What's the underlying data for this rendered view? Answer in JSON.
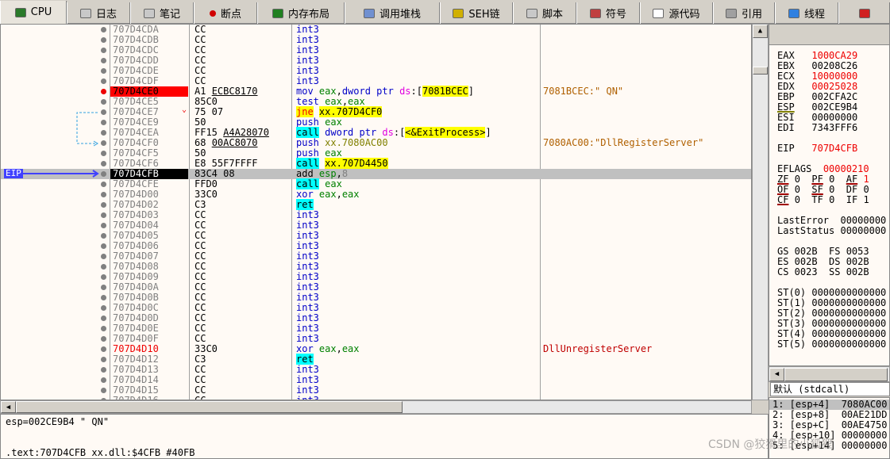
{
  "tabs": [
    {
      "label": "CPU",
      "icon": "cpu-icon",
      "color": "#2a7a2a",
      "active": true
    },
    {
      "label": "日志",
      "icon": "log-icon",
      "color": "#c8c8c8"
    },
    {
      "label": "笔记",
      "icon": "notes-icon",
      "color": "#c8c8c8"
    },
    {
      "label": "断点",
      "icon": "breakpoint-icon",
      "color": "#d00000"
    },
    {
      "label": "内存布局",
      "icon": "memory-map-icon",
      "color": "#208020"
    },
    {
      "label": "调用堆栈",
      "icon": "call-stack-icon",
      "color": "#7090d0"
    },
    {
      "label": "SEH链",
      "icon": "seh-chain-icon",
      "color": "#d0b000"
    },
    {
      "label": "脚本",
      "icon": "script-icon",
      "color": "#c8c8c8"
    },
    {
      "label": "符号",
      "icon": "symbols-icon",
      "color": "#c04040"
    },
    {
      "label": "源代码",
      "icon": "source-code-icon",
      "color": "#ffffff"
    },
    {
      "label": "引用",
      "icon": "references-icon",
      "color": "#a0a0a0"
    },
    {
      "label": "线程",
      "icon": "threads-icon",
      "color": "#3080e0"
    },
    {
      "label": "",
      "icon": "handles-icon",
      "color": "#d02020"
    }
  ],
  "disasm": {
    "eip_label": "EIP",
    "rows": [
      {
        "addr": "707D4CDA",
        "bytes": "CC",
        "ins": [
          [
            "mn",
            "int3"
          ]
        ]
      },
      {
        "addr": "707D4CDB",
        "bytes": "CC",
        "ins": [
          [
            "mn",
            "int3"
          ]
        ]
      },
      {
        "addr": "707D4CDC",
        "bytes": "CC",
        "ins": [
          [
            "mn",
            "int3"
          ]
        ]
      },
      {
        "addr": "707D4CDD",
        "bytes": "CC",
        "ins": [
          [
            "mn",
            "int3"
          ]
        ]
      },
      {
        "addr": "707D4CDE",
        "bytes": "CC",
        "ins": [
          [
            "mn",
            "int3"
          ]
        ]
      },
      {
        "addr": "707D4CDF",
        "bytes": "CC",
        "ins": [
          [
            "mn",
            "int3"
          ]
        ]
      },
      {
        "addr": "707D4CE0",
        "bytes": "A1 ",
        "bytes_u": "ECBC8170",
        "state": "bp",
        "ins": [
          [
            "mn",
            "mov "
          ],
          [
            "rg",
            "eax"
          ],
          [
            "pl",
            ","
          ],
          [
            "mn",
            "dword ptr "
          ],
          [
            "sg",
            "ds"
          ],
          [
            "pl",
            ":["
          ],
          [
            "hy",
            "7081BCEC"
          ],
          [
            "pl",
            "]"
          ]
        ],
        "comment": "7081BCEC:\" QN\""
      },
      {
        "addr": "707D4CE5",
        "bytes": "85C0",
        "ins": [
          [
            "mn",
            "test "
          ],
          [
            "rg",
            "eax"
          ],
          [
            "pl",
            ","
          ],
          [
            "rg",
            "eax"
          ]
        ]
      },
      {
        "addr": "707D4CE7",
        "bytes": "75 07",
        "jump": true,
        "ins": [
          [
            "jn",
            "jne"
          ],
          [
            "pl",
            " "
          ],
          [
            "hy",
            "xx.707D4CF0"
          ]
        ]
      },
      {
        "addr": "707D4CE9",
        "bytes": "50",
        "ins": [
          [
            "mn",
            "push "
          ],
          [
            "rg",
            "eax"
          ]
        ]
      },
      {
        "addr": "707D4CEA",
        "bytes": "FF15 ",
        "bytes_u": "A4A28070",
        "ins": [
          [
            "hc",
            "call"
          ],
          [
            "pl",
            " "
          ],
          [
            "mn",
            "dword ptr "
          ],
          [
            "sg",
            "ds"
          ],
          [
            "pl",
            ":["
          ],
          [
            "hy",
            "<&ExitProcess>"
          ],
          [
            "pl",
            "]"
          ]
        ]
      },
      {
        "addr": "707D4CF0",
        "bytes": "68 ",
        "bytes_u": "00AC8070",
        "ins": [
          [
            "mn",
            "push "
          ],
          [
            "ol",
            "xx.7080AC00"
          ]
        ],
        "comment": "7080AC00:\"DllRegisterServer\""
      },
      {
        "addr": "707D4CF5",
        "bytes": "50",
        "ins": [
          [
            "mn",
            "push "
          ],
          [
            "rg",
            "eax"
          ]
        ]
      },
      {
        "addr": "707D4CF6",
        "bytes": "E8 55F7FFFF",
        "ins": [
          [
            "hc",
            "call"
          ],
          [
            "pl",
            " "
          ],
          [
            "hy",
            "xx.707D4450"
          ]
        ]
      },
      {
        "addr": "707D4CFB",
        "bytes": "83C4 08",
        "state": "eip",
        "ins": [
          [
            "pl",
            "add "
          ],
          [
            "rg",
            "esp"
          ],
          [
            "pl",
            ","
          ],
          [
            "gy",
            "8"
          ]
        ]
      },
      {
        "addr": "707D4CFE",
        "bytes": "FFD0",
        "ins": [
          [
            "hc",
            "call"
          ],
          [
            "pl",
            " "
          ],
          [
            "rg",
            "eax"
          ]
        ]
      },
      {
        "addr": "707D4D00",
        "bytes": "33C0",
        "ins": [
          [
            "mn",
            "xor "
          ],
          [
            "rg",
            "eax"
          ],
          [
            "pl",
            ","
          ],
          [
            "rg",
            "eax"
          ]
        ]
      },
      {
        "addr": "707D4D02",
        "bytes": "C3",
        "ins": [
          [
            "hc",
            "ret"
          ]
        ]
      },
      {
        "addr": "707D4D03",
        "bytes": "CC",
        "ins": [
          [
            "mn",
            "int3"
          ]
        ]
      },
      {
        "addr": "707D4D04",
        "bytes": "CC",
        "ins": [
          [
            "mn",
            "int3"
          ]
        ]
      },
      {
        "addr": "707D4D05",
        "bytes": "CC",
        "ins": [
          [
            "mn",
            "int3"
          ]
        ]
      },
      {
        "addr": "707D4D06",
        "bytes": "CC",
        "ins": [
          [
            "mn",
            "int3"
          ]
        ]
      },
      {
        "addr": "707D4D07",
        "bytes": "CC",
        "ins": [
          [
            "mn",
            "int3"
          ]
        ]
      },
      {
        "addr": "707D4D08",
        "bytes": "CC",
        "ins": [
          [
            "mn",
            "int3"
          ]
        ]
      },
      {
        "addr": "707D4D09",
        "bytes": "CC",
        "ins": [
          [
            "mn",
            "int3"
          ]
        ]
      },
      {
        "addr": "707D4D0A",
        "bytes": "CC",
        "ins": [
          [
            "mn",
            "int3"
          ]
        ]
      },
      {
        "addr": "707D4D0B",
        "bytes": "CC",
        "ins": [
          [
            "mn",
            "int3"
          ]
        ]
      },
      {
        "addr": "707D4D0C",
        "bytes": "CC",
        "ins": [
          [
            "mn",
            "int3"
          ]
        ]
      },
      {
        "addr": "707D4D0D",
        "bytes": "CC",
        "ins": [
          [
            "mn",
            "int3"
          ]
        ]
      },
      {
        "addr": "707D4D0E",
        "bytes": "CC",
        "ins": [
          [
            "mn",
            "int3"
          ]
        ]
      },
      {
        "addr": "707D4D0F",
        "bytes": "CC",
        "ins": [
          [
            "mn",
            "int3"
          ]
        ]
      },
      {
        "addr": "707D4D10",
        "bytes": "33C0",
        "state": "red",
        "ins": [
          [
            "mn",
            "xor "
          ],
          [
            "rg",
            "eax"
          ],
          [
            "pl",
            ","
          ],
          [
            "rg",
            "eax"
          ]
        ],
        "comment": "DllUnregisterServer",
        "comment_color": "#c00000"
      },
      {
        "addr": "707D4D12",
        "bytes": "C3",
        "ins": [
          [
            "hc",
            "ret"
          ]
        ]
      },
      {
        "addr": "707D4D13",
        "bytes": "CC",
        "ins": [
          [
            "mn",
            "int3"
          ]
        ]
      },
      {
        "addr": "707D4D14",
        "bytes": "CC",
        "ins": [
          [
            "mn",
            "int3"
          ]
        ]
      },
      {
        "addr": "707D4D15",
        "bytes": "CC",
        "ins": [
          [
            "mn",
            "int3"
          ]
        ]
      },
      {
        "addr": "707D4D16",
        "bytes": "CC",
        "ins": [
          [
            "mn",
            "int3"
          ]
        ]
      }
    ]
  },
  "info": {
    "line1": "esp=002CE9B4 \" QN\"",
    "line2": ".text:707D4CFB xx.dll:$4CFB #40FB"
  },
  "registers": {
    "gp": [
      {
        "name": "EAX",
        "value": "1000CA29",
        "changed": true
      },
      {
        "name": "EBX",
        "value": "00208C26"
      },
      {
        "name": "ECX",
        "value": "10000000",
        "changed": true
      },
      {
        "name": "EDX",
        "value": "00025028",
        "changed": true
      },
      {
        "name": "EBP",
        "value": "002CFA2C"
      },
      {
        "name": "ESP",
        "value": "002CE9B4",
        "underline": true
      },
      {
        "name": "ESI",
        "value": "00000000"
      },
      {
        "name": "EDI",
        "value": "7343FFF6"
      }
    ],
    "eip": {
      "name": "EIP",
      "value": "707D4CFB"
    },
    "eflags": {
      "name": "EFLAGS",
      "value": "00000210"
    },
    "flags": [
      [
        {
          "n": "ZF",
          "v": "0",
          "u": true
        },
        {
          "n": "PF",
          "v": "0",
          "u": true
        },
        {
          "n": "AF",
          "v": "1",
          "u": true,
          "c": true
        }
      ],
      [
        {
          "n": "OF",
          "v": "0",
          "u": true
        },
        {
          "n": "SF",
          "v": "0",
          "u": true
        },
        {
          "n": "DF",
          "v": "0"
        }
      ],
      [
        {
          "n": "CF",
          "v": "0",
          "u": true
        },
        {
          "n": "TF",
          "v": "0"
        },
        {
          "n": "IF",
          "v": "1"
        }
      ]
    ],
    "last_error": "LastError  00000000",
    "last_status": "LastStatus 00000000",
    "segs": [
      "GS 002B  FS 0053",
      "ES 002B  DS 002B",
      "CS 0023  SS 002B"
    ],
    "fpu": [
      "ST(0) 0000000000000",
      "ST(1) 0000000000000",
      "ST(2) 0000000000000",
      "ST(3) 0000000000000",
      "ST(4) 0000000000000",
      "ST(5) 0000000000000"
    ]
  },
  "callconv": "默认 (stdcall)",
  "stack_args": [
    "1: [esp+4]  7080AC00",
    "2: [esp+8]  00AE21DD",
    "3: [esp+C]  00AE4750",
    "4: [esp+10] 00000000",
    "5: [esp+14] 00000000"
  ],
  "watermark": "CSDN @狡猾里的小狐狸"
}
